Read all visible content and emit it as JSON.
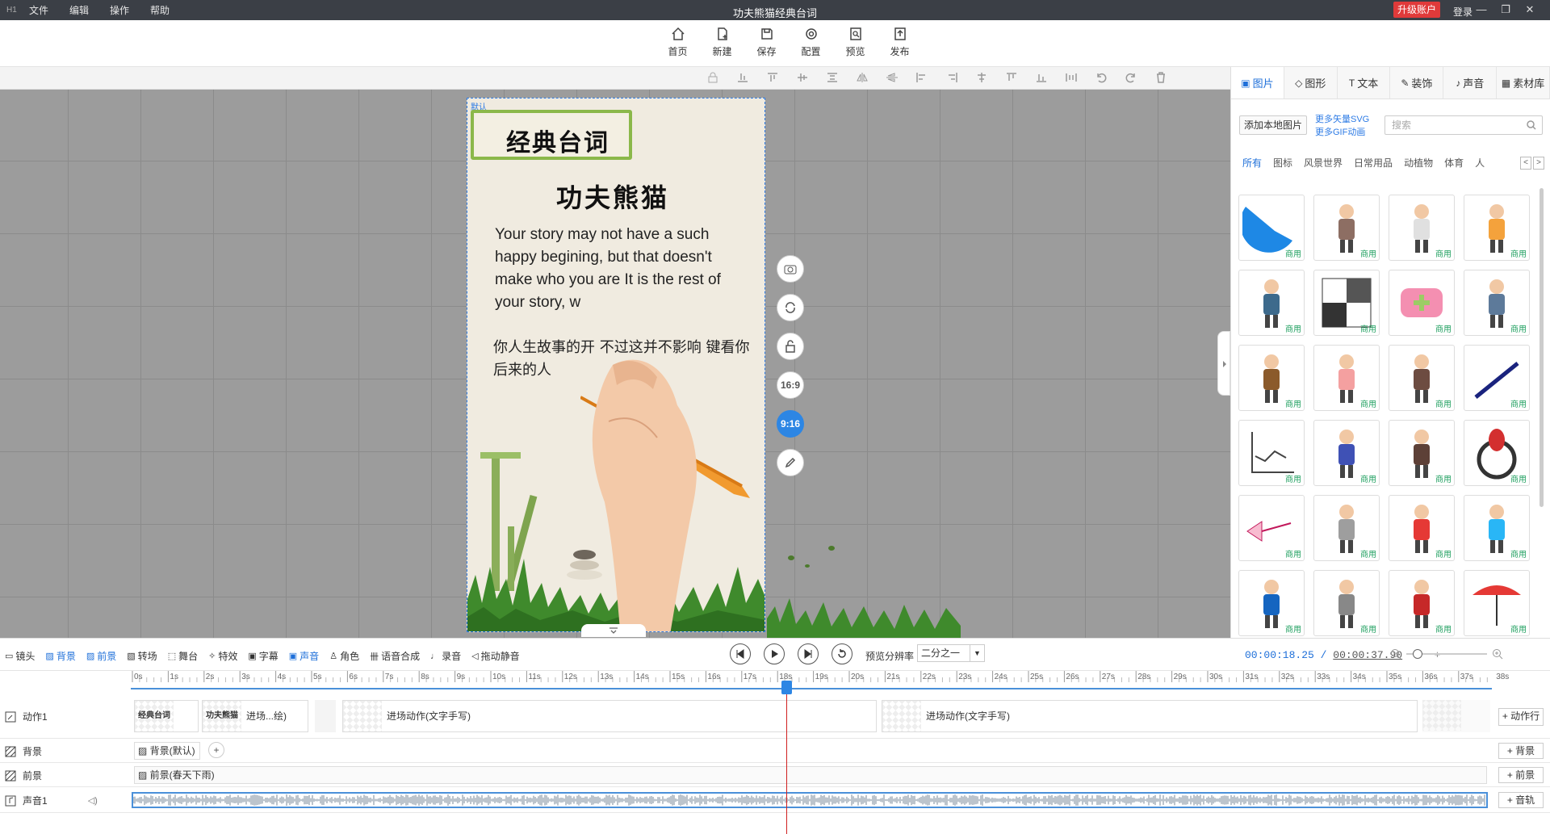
{
  "window": {
    "logo": "H1",
    "title": "功夫熊猫经典台词",
    "upgrade": "升级账户",
    "login": "登录",
    "menu": [
      "文件",
      "编辑",
      "操作",
      "帮助"
    ]
  },
  "toolbar": {
    "items": [
      {
        "label": "首页",
        "icon": "home-icon"
      },
      {
        "label": "新建",
        "icon": "new-file-icon"
      },
      {
        "label": "保存",
        "icon": "save-icon"
      },
      {
        "label": "配置",
        "icon": "settings-icon"
      },
      {
        "label": "预览",
        "icon": "preview-icon"
      },
      {
        "label": "发布",
        "icon": "publish-icon"
      }
    ]
  },
  "stage": {
    "tag": "默认",
    "sign_text": "经典台词",
    "title": "功夫熊猫",
    "english": "Your story may not have a such happy begining, but that doesn't make who you are  It is the rest of your story, w",
    "chinese": "你人生故事的开          不过这并不影响          键看你后来的人"
  },
  "side_buttons": [
    "camera-add-icon",
    "rotate-icon",
    "unlock-icon",
    "16:9",
    "9:16",
    "edit-icon"
  ],
  "right_panel": {
    "tabs": [
      {
        "label": "图片",
        "icon": "▣"
      },
      {
        "label": "图形",
        "icon": "◇"
      },
      {
        "label": "文本",
        "icon": "T"
      },
      {
        "label": "装饰",
        "icon": "✎"
      },
      {
        "label": "声音",
        "icon": "♪"
      },
      {
        "label": "素材库",
        "icon": "▦"
      }
    ],
    "add_local": "添加本地图片",
    "more_svg": "更多矢量SVG",
    "more_gif": "更多GIF动画",
    "search_placeholder": "搜索",
    "categories": [
      "所有",
      "图标",
      "风景世界",
      "日常用品",
      "动植物",
      "体育",
      "人"
    ],
    "tag": "商用",
    "items": [
      "blue-shape",
      "building",
      "cup",
      "tiger",
      "people-chat",
      "checker-scribble",
      "pink-plus",
      "man-standing",
      "worker",
      "couple-talk",
      "basket",
      "pen",
      "line-chart",
      "man-blue",
      "man-dark",
      "ring-gem",
      "arrow",
      "van",
      "superman",
      "computer",
      "man-thinking",
      "cat",
      "boy-red",
      "umbrella"
    ]
  },
  "timeline": {
    "toggles": [
      {
        "label": "镜头",
        "icon": "▭",
        "active": false
      },
      {
        "label": "背景",
        "icon": "▨",
        "active": true
      },
      {
        "label": "前景",
        "icon": "▨",
        "active": true
      },
      {
        "label": "转场",
        "icon": "▧",
        "active": false
      },
      {
        "label": "舞台",
        "icon": "⬚",
        "active": false
      },
      {
        "label": "特效",
        "icon": "✧",
        "active": false
      },
      {
        "label": "字幕",
        "icon": "▣",
        "active": false
      },
      {
        "label": "声音",
        "icon": "▣",
        "active": true
      },
      {
        "label": "角色",
        "icon": "♙",
        "active": false
      },
      {
        "label": "语音合成",
        "icon": "卌",
        "active": false
      },
      {
        "label": "录音",
        "icon": "♩",
        "active": false
      },
      {
        "label": "拖动静音",
        "icon": "◁",
        "active": false
      }
    ],
    "preview_label": "预览分辨率",
    "preview_value": "二分之一",
    "current_time": "00:00:18.25",
    "separator": "/",
    "total_time": "00:00:37.90",
    "ruler": [
      "0s",
      "1s",
      "2s",
      "3s",
      "4s",
      "5s",
      "6s",
      "7s",
      "8s",
      "9s",
      "10s",
      "11s",
      "12s",
      "13s",
      "14s",
      "15s",
      "16s",
      "17s",
      "18s",
      "19s",
      "20s",
      "21s",
      "22s",
      "23s",
      "24s",
      "25s",
      "26s",
      "27s",
      "28s",
      "29s",
      "30s",
      "31s",
      "32s",
      "33s",
      "34s",
      "35s",
      "36s",
      "37s",
      "38s"
    ],
    "tracks": {
      "action": {
        "label": "动作1",
        "add": "+ 动作行",
        "clips": [
          {
            "thumb": "经典台词",
            "text": ""
          },
          {
            "thumb": "功夫熊猫",
            "text": "进场...绘)"
          },
          {
            "thumb": "",
            "text": ""
          },
          {
            "thumb": "",
            "text": "进场动作(文字手写)"
          },
          {
            "thumb": "",
            "text": "进场动作(文字手写)"
          },
          {
            "thumb": "",
            "text": ""
          }
        ]
      },
      "background": {
        "label": "背景",
        "add": "+ 背景",
        "clip": "背景(默认)"
      },
      "foreground": {
        "label": "前景",
        "add": "+ 前景",
        "clip": "前景(春天下雨)"
      },
      "audio": {
        "label": "声音1",
        "add": "+ 音轨"
      }
    }
  }
}
